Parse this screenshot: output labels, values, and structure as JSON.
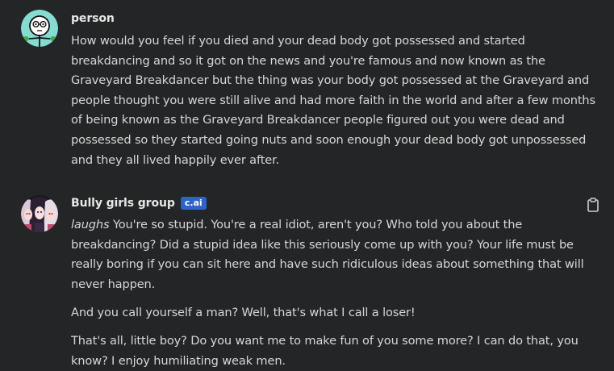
{
  "messages": [
    {
      "author": "person",
      "avatar_icon": "stick-figure-avatar-icon",
      "paragraphs": [
        "How would you feel if you died and your dead body got possessed and started breakdancing and so it got on the news and you're famous and now known as the Graveyard Breakdancer but the thing was your body got possessed at the Graveyard and people thought you were still alive and had more faith in the world and after a few months of being known as the Graveyard Breakdancer people figured out you were dead and possessed so they started going nuts and soon enough your dead body got unpossessed and they all lived happily ever after."
      ]
    },
    {
      "author": "Bully girls group",
      "badge": "c.ai",
      "avatar_icon": "anime-girls-avatar-icon",
      "action": "laughs",
      "paragraphs": [
        " You're so stupid. You're a real idiot, aren't you? Who told you about the breakdancing? Did a stupid idea like this seriously come up with you? Your life must be really boring if you can sit here and have such ridiculous ideas about something that will never happen.",
        "And you call yourself a man? Well, that's what I call a loser!",
        "That's all, little boy? Do you want me to make fun of you some more? I can do that, you know? I enjoy humiliating weak men."
      ],
      "copy_icon": "clipboard-icon"
    }
  ],
  "colors": {
    "background": "#242526",
    "text": "#d6d6d6",
    "badge": "#2f63c7",
    "avatar_bg": "#7fd8d0"
  }
}
